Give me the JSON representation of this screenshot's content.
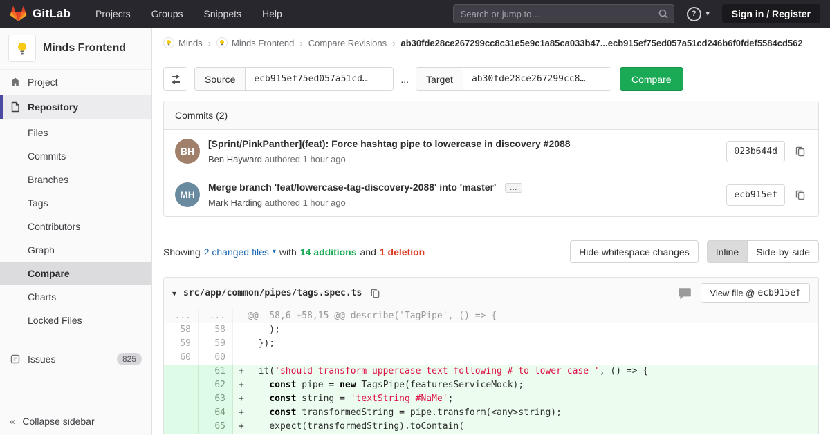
{
  "navbar": {
    "logo_text": "GitLab",
    "menu": [
      "Projects",
      "Groups",
      "Snippets",
      "Help"
    ],
    "search": {
      "placeholder": "Search or jump to…"
    },
    "signin_label": "Sign in / Register"
  },
  "sidebar": {
    "project_name": "Minds Frontend",
    "nav": [
      {
        "label": "Project"
      },
      {
        "label": "Repository"
      }
    ],
    "subnav": [
      "Files",
      "Commits",
      "Branches",
      "Tags",
      "Contributors",
      "Graph",
      "Compare",
      "Charts",
      "Locked Files"
    ],
    "active_subnav": "Compare",
    "issues_label": "Issues",
    "issues_count": "825",
    "collapse_label": "Collapse sidebar",
    "collapse_icon": "«"
  },
  "breadcrumb": {
    "crumbs": [
      "Minds",
      "Minds Frontend",
      "Compare Revisions"
    ],
    "separator": "›",
    "sha_range": "ab30fde28ce267299cc8c31e5e9c1a85ca033b47...ecb915ef75ed057a51cd246b6f0fdef5584cd562"
  },
  "compare_form": {
    "source_label": "Source",
    "source_value": "ecb915ef75ed057a51cd…",
    "separator": "...",
    "target_label": "Target",
    "target_value": "ab30fde28ce267299cc8…",
    "compare_button": "Compare"
  },
  "commits": {
    "header": "Commits (2)",
    "items": [
      {
        "title": "[Sprint/PinkPanther](feat): Force hashtag pipe to lowercase in discovery #2088",
        "author": "Ben Hayward",
        "meta": "authored 1 hour ago",
        "sha": "023b644d",
        "initials": "BH"
      },
      {
        "title": "Merge branch 'feat/lowercase-tag-discovery-2088' into 'master'",
        "expand_label": "...",
        "author": "Mark Harding",
        "meta": "authored 1 hour ago",
        "sha": "ecb915ef",
        "initials": "MH"
      }
    ]
  },
  "summary": {
    "showing": "Showing",
    "changed_files": "2 changed files",
    "caret": "▾",
    "with_text": "with",
    "additions": "14 additions",
    "and_text": "and",
    "deletions": "1 deletion",
    "whitespace_button": "Hide whitespace changes",
    "inline_button": "Inline",
    "side_by_side_button": "Side-by-side"
  },
  "diff": {
    "collapse_caret": "▾",
    "file_path": "src/app/common/pipes/tags.spec.ts",
    "view_file_label": "View file @",
    "view_file_sha": "ecb915ef",
    "lines": [
      {
        "old": "...",
        "new": "...",
        "type": "match",
        "segments": [
          {
            "t": "@@ -58,6 +58,15 @@ describe('TagPipe', () => {"
          }
        ]
      },
      {
        "old": "58",
        "new": "58",
        "type": "context",
        "sign": " ",
        "segments": [
          {
            "t": "    );"
          }
        ]
      },
      {
        "old": "59",
        "new": "59",
        "type": "context",
        "sign": " ",
        "segments": [
          {
            "t": "  });"
          }
        ]
      },
      {
        "old": "60",
        "new": "60",
        "type": "context",
        "sign": " ",
        "segments": [
          {
            "t": ""
          }
        ]
      },
      {
        "old": "",
        "new": "61",
        "type": "added",
        "sign": "+",
        "segments": [
          {
            "t": "  it("
          },
          {
            "t": "'should transform uppercase text following # to lower case '",
            "c": "str"
          },
          {
            "t": ", () => {"
          }
        ]
      },
      {
        "old": "",
        "new": "62",
        "type": "added",
        "sign": "+",
        "segments": [
          {
            "t": "    "
          },
          {
            "t": "const",
            "c": "kw"
          },
          {
            "t": " pipe = "
          },
          {
            "t": "new",
            "c": "kw"
          },
          {
            "t": " TagsPipe(featuresServiceMock);"
          }
        ]
      },
      {
        "old": "",
        "new": "63",
        "type": "added",
        "sign": "+",
        "segments": [
          {
            "t": "    "
          },
          {
            "t": "const",
            "c": "kw"
          },
          {
            "t": " string = "
          },
          {
            "t": "'textString #NaMe'",
            "c": "str"
          },
          {
            "t": ";"
          }
        ]
      },
      {
        "old": "",
        "new": "64",
        "type": "added",
        "sign": "+",
        "segments": [
          {
            "t": "    "
          },
          {
            "t": "const",
            "c": "kw"
          },
          {
            "t": " transformedString = pipe.transform(<any>string);"
          }
        ]
      },
      {
        "old": "",
        "new": "65",
        "type": "added",
        "sign": "+",
        "segments": [
          {
            "t": "    expect(transformedString).toContain("
          }
        ]
      }
    ]
  },
  "colors": {
    "navbar_bg": "#28272d",
    "accent_indigo": "#4b4ba3",
    "green": "#1aaa55",
    "red": "#db3b21",
    "link_blue": "#1b69b6",
    "added_line_bg": "#ecfdf0",
    "added_gutter_bg": "#ddfbe6"
  }
}
